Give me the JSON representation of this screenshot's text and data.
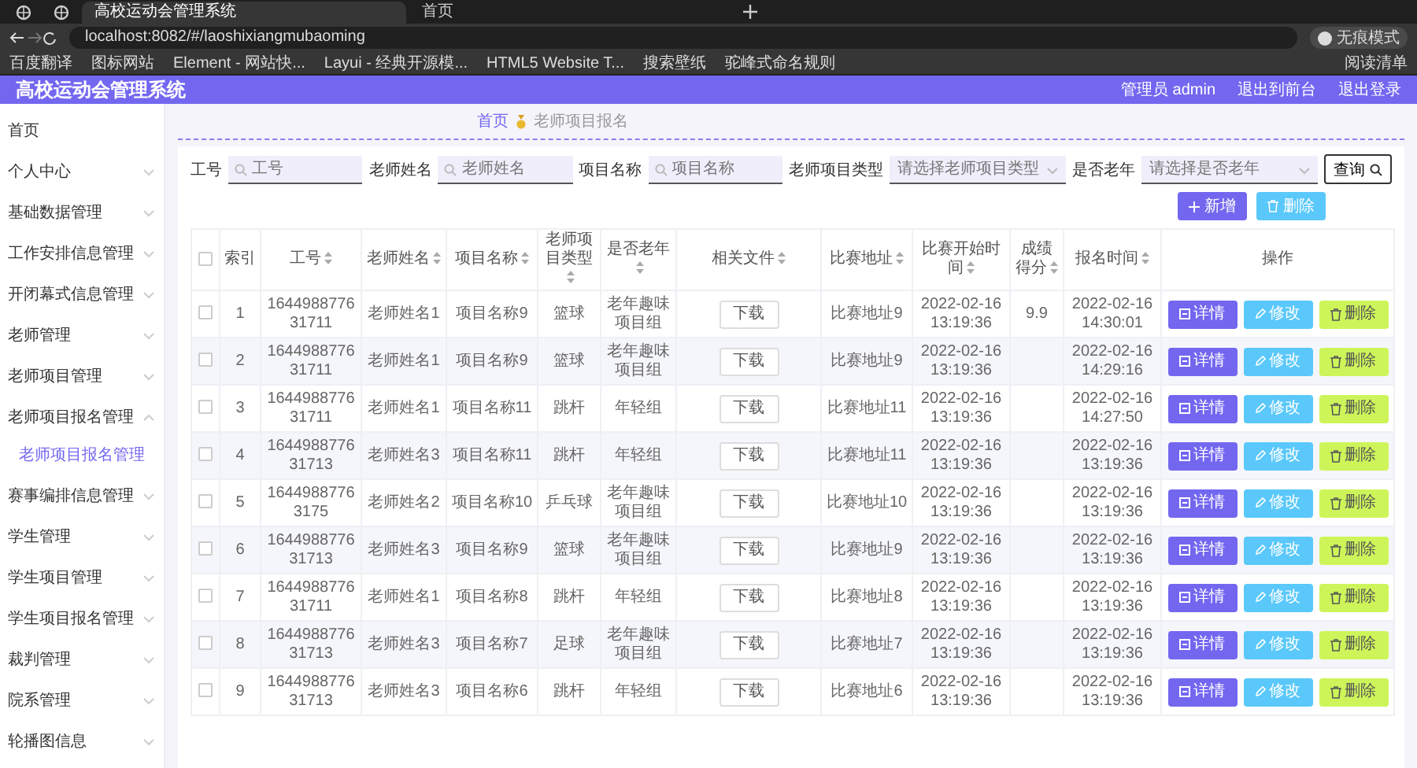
{
  "browser": {
    "tabs": [
      {
        "kind": "pinned",
        "selected": false
      },
      {
        "kind": "pinned",
        "selected": false
      },
      {
        "title": "高校运动会管理系统",
        "kind": "page",
        "selected": true
      },
      {
        "title": "首页",
        "kind": "page",
        "selected": false
      }
    ],
    "url": "localhost:8082/#/laoshixiangmubaoming",
    "profile_label": "无痕模式",
    "bookmarks": [
      "百度翻译",
      "图标网站",
      "Element - 网站快...",
      "Layui - 经典开源模...",
      "HTML5 Website T...",
      "搜索壁纸",
      "驼峰式命名规则"
    ],
    "reading_list": "阅读清单"
  },
  "header": {
    "title": "高校运动会管理系统",
    "user": "管理员 admin",
    "links": [
      "退出到前台",
      "退出登录"
    ]
  },
  "sidebar": {
    "items": [
      {
        "label": "首页",
        "kind": "link"
      },
      {
        "label": "个人中心",
        "kind": "menu",
        "expanded": false
      },
      {
        "label": "基础数据管理",
        "kind": "menu",
        "expanded": false
      },
      {
        "label": "工作安排信息管理",
        "kind": "menu",
        "expanded": false
      },
      {
        "label": "开闭幕式信息管理",
        "kind": "menu",
        "expanded": false
      },
      {
        "label": "老师管理",
        "kind": "menu",
        "expanded": false
      },
      {
        "label": "老师项目管理",
        "kind": "menu",
        "expanded": false
      },
      {
        "label": "老师项目报名管理",
        "kind": "menu",
        "expanded": true,
        "children": [
          {
            "label": "老师项目报名管理",
            "selected": true
          }
        ]
      },
      {
        "label": "赛事编排信息管理",
        "kind": "menu",
        "expanded": false
      },
      {
        "label": "学生管理",
        "kind": "menu",
        "expanded": false
      },
      {
        "label": "学生项目管理",
        "kind": "menu",
        "expanded": false
      },
      {
        "label": "学生项目报名管理",
        "kind": "menu",
        "expanded": false
      },
      {
        "label": "裁判管理",
        "kind": "menu",
        "expanded": false
      },
      {
        "label": "院系管理",
        "kind": "menu",
        "expanded": false
      },
      {
        "label": "轮播图信息",
        "kind": "menu",
        "expanded": false
      }
    ]
  },
  "breadcrumb": [
    "首页",
    "老师项目报名"
  ],
  "filters": [
    {
      "label": "工号",
      "placeholder": "工号",
      "kind": "text"
    },
    {
      "label": "老师姓名",
      "placeholder": "老师姓名",
      "kind": "text"
    },
    {
      "label": "项目名称",
      "placeholder": "项目名称",
      "kind": "text"
    },
    {
      "label": "老师项目类型",
      "placeholder": "请选择老师项目类型",
      "kind": "select"
    },
    {
      "label": "是否老年",
      "placeholder": "请选择是否老年",
      "kind": "select"
    }
  ],
  "search_button": "查询",
  "actions": [
    {
      "label": "新增",
      "kind": "add"
    },
    {
      "label": "删除",
      "kind": "delete"
    }
  ],
  "table": {
    "header_checked": false,
    "columns": [
      {
        "label": "索引",
        "sortable": false
      },
      {
        "label": "工号",
        "sortable": true
      },
      {
        "label": "老师姓名",
        "sortable": true
      },
      {
        "label": "项目名称",
        "sortable": true
      },
      {
        "label": "老师项目类型",
        "sortable": true
      },
      {
        "label": "是否老年",
        "sortable": true
      },
      {
        "label": "相关文件",
        "sortable": true
      },
      {
        "label": "比赛地址",
        "sortable": true
      },
      {
        "label": "比赛开始时间",
        "sortable": true
      },
      {
        "label": "成绩得分",
        "sortable": true
      },
      {
        "label": "报名时间",
        "sortable": true
      },
      {
        "label": "操作",
        "sortable": false
      }
    ],
    "rows": [
      {
        "checked": false,
        "cells": [
          "1",
          "164498877631711",
          "老师姓名1",
          "项目名称9",
          "篮球",
          "老年趣味项目组"
        ],
        "file": "下载",
        "address": "比赛地址9",
        "start": "2022-02-16 13:19:36",
        "score": "9.9",
        "signup": "2022-02-16 14:30:01",
        "buttons": [
          {
            "label": "详情",
            "kind": "detail"
          },
          {
            "label": "修改",
            "kind": "edit"
          },
          {
            "label": "删除",
            "kind": "delete"
          }
        ]
      },
      {
        "checked": false,
        "cells": [
          "2",
          "164498877631711",
          "老师姓名1",
          "项目名称9",
          "篮球",
          "老年趣味项目组"
        ],
        "file": "下载",
        "address": "比赛地址9",
        "start": "2022-02-16 13:19:36",
        "signup": "2022-02-16 14:29:16",
        "buttons": [
          {
            "label": "详情",
            "kind": "detail"
          },
          {
            "label": "修改",
            "kind": "edit"
          },
          {
            "label": "删除",
            "kind": "delete"
          }
        ]
      },
      {
        "checked": false,
        "cells": [
          "3",
          "164498877631711",
          "老师姓名1",
          "项目名称11",
          "跳杆",
          "年轻组"
        ],
        "file": "下载",
        "address": "比赛地址11",
        "start": "2022-02-16 13:19:36",
        "signup": "2022-02-16 14:27:50",
        "buttons": [
          {
            "label": "详情",
            "kind": "detail"
          },
          {
            "label": "修改",
            "kind": "edit"
          },
          {
            "label": "删除",
            "kind": "delete"
          }
        ]
      },
      {
        "checked": false,
        "cells": [
          "4",
          "164498877631713",
          "老师姓名3",
          "项目名称11",
          "跳杆",
          "年轻组"
        ],
        "file": "下载",
        "address": "比赛地址11",
        "start": "2022-02-16 13:19:36",
        "signup": "2022-02-16 13:19:36",
        "buttons": [
          {
            "label": "详情",
            "kind": "detail"
          },
          {
            "label": "修改",
            "kind": "edit"
          },
          {
            "label": "删除",
            "kind": "delete"
          }
        ]
      },
      {
        "checked": false,
        "cells": [
          "5",
          "16449887763175",
          "老师姓名2",
          "项目名称10",
          "乒乓球",
          "老年趣味项目组"
        ],
        "file": "下载",
        "address": "比赛地址10",
        "start": "2022-02-16 13:19:36",
        "signup": "2022-02-16 13:19:36",
        "buttons": [
          {
            "label": "详情",
            "kind": "detail"
          },
          {
            "label": "修改",
            "kind": "edit"
          },
          {
            "label": "删除",
            "kind": "delete"
          }
        ]
      },
      {
        "checked": false,
        "cells": [
          "6",
          "164498877631713",
          "老师姓名3",
          "项目名称9",
          "篮球",
          "老年趣味项目组"
        ],
        "file": "下载",
        "address": "比赛地址9",
        "start": "2022-02-16 13:19:36",
        "signup": "2022-02-16 13:19:36",
        "buttons": [
          {
            "label": "详情",
            "kind": "detail"
          },
          {
            "label": "修改",
            "kind": "edit"
          },
          {
            "label": "删除",
            "kind": "delete"
          }
        ]
      },
      {
        "checked": false,
        "cells": [
          "7",
          "164498877631711",
          "老师姓名1",
          "项目名称8",
          "跳杆",
          "年轻组"
        ],
        "file": "下载",
        "address": "比赛地址8",
        "start": "2022-02-16 13:19:36",
        "signup": "2022-02-16 13:19:36",
        "buttons": [
          {
            "label": "详情",
            "kind": "detail"
          },
          {
            "label": "修改",
            "kind": "edit"
          },
          {
            "label": "删除",
            "kind": "delete"
          }
        ]
      },
      {
        "checked": false,
        "cells": [
          "8",
          "164498877631713",
          "老师姓名3",
          "项目名称7",
          "足球",
          "老年趣味项目组"
        ],
        "file": "下载",
        "address": "比赛地址7",
        "start": "2022-02-16 13:19:36",
        "signup": "2022-02-16 13:19:36",
        "buttons": [
          {
            "label": "详情",
            "kind": "detail"
          },
          {
            "label": "修改",
            "kind": "edit"
          },
          {
            "label": "删除",
            "kind": "delete"
          }
        ]
      },
      {
        "checked": false,
        "cells": [
          "9",
          "164498877631713",
          "老师姓名3",
          "项目名称6",
          "跳杆",
          "年轻组"
        ],
        "file": "下载",
        "address": "比赛地址6",
        "start": "2022-02-16 13:19:36",
        "signup": "2022-02-16 13:19:36",
        "buttons": [
          {
            "label": "详情",
            "kind": "detail"
          },
          {
            "label": "修改",
            "kind": "edit"
          },
          {
            "label": "删除",
            "kind": "delete"
          }
        ]
      }
    ]
  }
}
